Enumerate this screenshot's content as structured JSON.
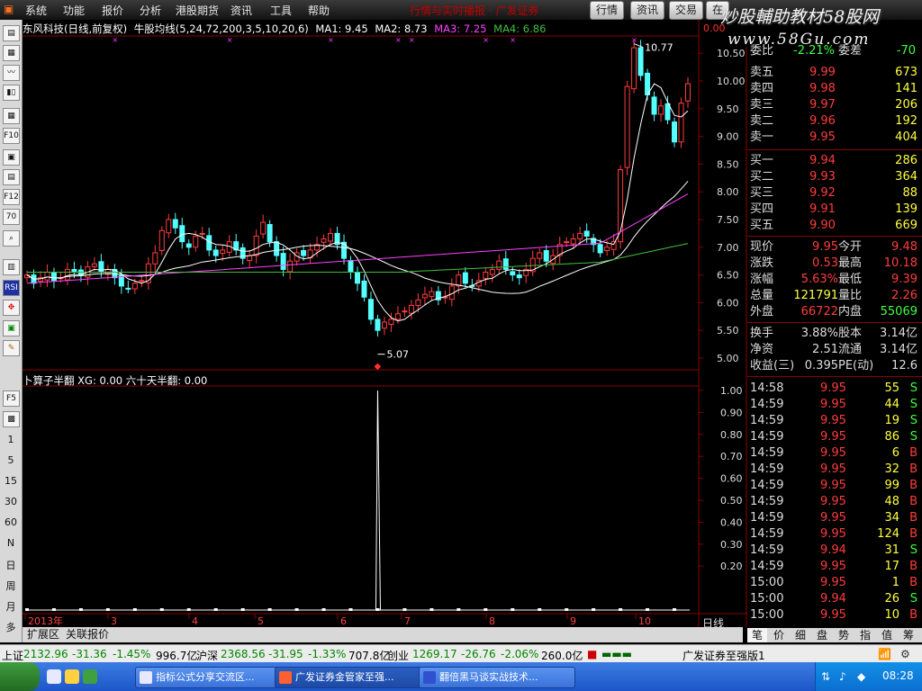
{
  "menubar": {
    "items": [
      "系统",
      "功能",
      "报价",
      "分析",
      "港股期货",
      "资讯",
      "工具",
      "帮助"
    ],
    "marquee": "行情与实时播报 · 广发证券",
    "tabs": [
      "行情",
      "资讯",
      "交易",
      "在"
    ],
    "watermark": "炒股輔助教材58股网",
    "watermark_url": "www.58Gu.com"
  },
  "toolbar": {
    "icons": [
      "app-logo-icon",
      "quote-list-icon",
      "multi-stock-icon",
      "line-chart-icon",
      "kline-icon",
      "f10-icon",
      "f10-doc-icon",
      "finance-icon",
      "notepad-icon",
      "f-icon",
      "70-icon",
      "search-icon",
      "volume-icon",
      "rsi-icon",
      "move-icon",
      "indicator-icon",
      "draw-pen-icon",
      "f5-icon",
      "picture-icon"
    ],
    "labels": [
      "1",
      "5",
      "15",
      "30",
      "60",
      "N",
      "日",
      "周",
      "月",
      "多"
    ]
  },
  "chart": {
    "stock": "东风科技(日线,前复权)",
    "indicator_name": "牛股均线(5,24,72,200,3,5,10,20,6)",
    "ma1": "MA1: 9.45",
    "ma2": "MA2: 8.73",
    "ma3": "MA3: 7.25",
    "ma4": "MA4: 6.86",
    "high_label": "10.77",
    "low_label": "5.07",
    "indicator_legend": "卜算子半翻 XG: 0.00 六十天半翻: 0.00",
    "price_axis": [
      "10.50",
      "10.00",
      "9.50",
      "9.00",
      "8.50",
      "8.00",
      "7.50",
      "7.00",
      "6.50",
      "6.00",
      "5.50",
      "5.00"
    ],
    "ind_axis": [
      "1.00",
      "0.90",
      "0.80",
      "0.70",
      "0.60",
      "0.50",
      "0.40",
      "0.30",
      "0.20"
    ],
    "months": [
      "2013年",
      "3",
      "4",
      "5",
      "6",
      "7",
      "8",
      "9",
      "10"
    ],
    "period": "日线",
    "corner_value": "0.00",
    "colors": {
      "up": "#ff3c3c",
      "down": "#54ffff",
      "ma1": "#ffffff",
      "ma2": "#ffffff",
      "ma3": "#ff40ff",
      "ma4": "#40c040"
    }
  },
  "chart_data": {
    "type": "candlestick",
    "xlabel": "",
    "ylabel": "",
    "ylim": [
      4.9,
      10.6
    ],
    "series": [
      {
        "name": "MA1",
        "value": 9.45
      },
      {
        "name": "MA2",
        "value": 8.73
      },
      {
        "name": "MA3",
        "value": 7.25
      },
      {
        "name": "MA4",
        "value": 6.86
      }
    ],
    "annotations": [
      {
        "label": "10.77"
      },
      {
        "label": "5.07"
      }
    ],
    "closes": [
      6.5,
      6.35,
      6.45,
      6.55,
      6.4,
      6.45,
      6.6,
      6.55,
      6.5,
      6.65,
      6.7,
      6.55,
      6.6,
      6.45,
      6.3,
      6.25,
      6.35,
      6.4,
      6.7,
      6.9,
      7.3,
      7.5,
      7.35,
      7.1,
      7.0,
      7.2,
      7.25,
      6.95,
      6.85,
      6.95,
      7.1,
      6.95,
      6.8,
      6.85,
      7.2,
      7.45,
      7.1,
      6.85,
      6.6,
      6.75,
      6.9,
      6.85,
      6.95,
      7.05,
      7.15,
      7.25,
      7.05,
      6.8,
      6.55,
      6.35,
      6.1,
      5.7,
      5.5,
      5.65,
      5.7,
      5.8,
      5.85,
      5.95,
      6.05,
      6.15,
      6.2,
      6.05,
      6.1,
      6.3,
      6.5,
      6.35,
      6.3,
      6.4,
      6.55,
      6.6,
      6.75,
      6.6,
      6.5,
      6.45,
      6.6,
      6.8,
      6.9,
      6.75,
      6.85,
      7.05,
      7.1,
      7.15,
      7.25,
      7.2,
      7.05,
      6.9,
      7.0,
      7.1,
      8.4,
      9.9,
      10.6,
      10.1,
      9.75,
      9.4,
      9.55,
      9.3,
      8.9,
      9.6,
      9.95
    ],
    "indicator": {
      "name": "XG",
      "signal_day_index": 52,
      "peak": 1.0
    }
  },
  "quote": {
    "partial_row": {
      "label": "委比",
      "value": "-2.21%",
      "label2": "委差",
      "value2": "-70"
    },
    "sell": [
      {
        "label": "卖五",
        "price": "9.99",
        "vol": "673"
      },
      {
        "label": "卖四",
        "price": "9.98",
        "vol": "141"
      },
      {
        "label": "卖三",
        "price": "9.97",
        "vol": "206"
      },
      {
        "label": "卖二",
        "price": "9.96",
        "vol": "192"
      },
      {
        "label": "卖一",
        "price": "9.95",
        "vol": "404"
      }
    ],
    "buy": [
      {
        "label": "买一",
        "price": "9.94",
        "vol": "286"
      },
      {
        "label": "买二",
        "price": "9.93",
        "vol": "364"
      },
      {
        "label": "买三",
        "price": "9.92",
        "vol": "88"
      },
      {
        "label": "买四",
        "price": "9.91",
        "vol": "139"
      },
      {
        "label": "买五",
        "price": "9.90",
        "vol": "669"
      }
    ],
    "stats": [
      {
        "l1": "现价",
        "v1": "9.95",
        "l2": "今开",
        "v2": "9.48",
        "c1": "#ff3c3c",
        "c2": "#ff3c3c"
      },
      {
        "l1": "涨跌",
        "v1": "0.53",
        "l2": "最高",
        "v2": "10.18",
        "c1": "#ff3c3c",
        "c2": "#ff3c3c"
      },
      {
        "l1": "涨幅",
        "v1": "5.63%",
        "l2": "最低",
        "v2": "9.39",
        "c1": "#ff3c3c",
        "c2": "#ff3c3c"
      },
      {
        "l1": "总量",
        "v1": "121791",
        "l2": "量比",
        "v2": "2.26",
        "c1": "#ffff40",
        "c2": "#ff3c3c"
      },
      {
        "l1": "外盘",
        "v1": "66722",
        "l2": "内盘",
        "v2": "55069",
        "c1": "#ff3c3c",
        "c2": "#40ff40"
      }
    ],
    "stats2": [
      {
        "l1": "换手",
        "v1": "3.88%",
        "l2": "股本",
        "v2": "3.14亿"
      },
      {
        "l1": "净资",
        "v1": "2.51",
        "l2": "流通",
        "v2": "3.14亿"
      },
      {
        "l1": "收益(三)",
        "v1": "0.395",
        "l2": "PE(动)",
        "v2": "12.6"
      }
    ],
    "ticks": [
      {
        "time": "14:58",
        "price": "9.95",
        "vol": "55",
        "dir": "S"
      },
      {
        "time": "14:59",
        "price": "9.95",
        "vol": "44",
        "dir": "S"
      },
      {
        "time": "14:59",
        "price": "9.95",
        "vol": "19",
        "dir": "S"
      },
      {
        "time": "14:59",
        "price": "9.95",
        "vol": "86",
        "dir": "S"
      },
      {
        "time": "14:59",
        "price": "9.95",
        "vol": "6",
        "dir": "B"
      },
      {
        "time": "14:59",
        "price": "9.95",
        "vol": "32",
        "dir": "B"
      },
      {
        "time": "14:59",
        "price": "9.95",
        "vol": "99",
        "dir": "B"
      },
      {
        "time": "14:59",
        "price": "9.95",
        "vol": "48",
        "dir": "B"
      },
      {
        "time": "14:59",
        "price": "9.95",
        "vol": "34",
        "dir": "B"
      },
      {
        "time": "14:59",
        "price": "9.95",
        "vol": "124",
        "dir": "B"
      },
      {
        "time": "14:59",
        "price": "9.94",
        "vol": "31",
        "dir": "S"
      },
      {
        "time": "14:59",
        "price": "9.95",
        "vol": "17",
        "dir": "B"
      },
      {
        "time": "15:00",
        "price": "9.95",
        "vol": "1",
        "dir": "B"
      },
      {
        "time": "15:00",
        "price": "9.94",
        "vol": "26",
        "dir": "S"
      },
      {
        "time": "15:00",
        "price": "9.95",
        "vol": "10",
        "dir": "B"
      }
    ]
  },
  "footer": {
    "tabs": [
      "扩展区",
      "关联报价"
    ]
  },
  "panel_tabs": [
    "笔",
    "价",
    "细",
    "盘",
    "势",
    "指",
    "值",
    "筹"
  ],
  "status": {
    "sh_label": "上证",
    "sh_value": "2132.96",
    "sh_chg": "-31.36",
    "sh_pct": "-1.45%",
    "sh_amt": "996.7亿",
    "sz_label": "沪深",
    "sz_value": "2368.56",
    "sz_chg": "-31.95",
    "sz_pct": "-1.33%",
    "sz_amt": "707.8亿",
    "cy_label": "创业",
    "cy_value": "1269.17",
    "cy_chg": "-26.76",
    "cy_pct": "-2.06%",
    "cy_amt": "260.0亿",
    "broker": "广发证券至强版1"
  },
  "taskbar": {
    "tasks": [
      "指标公式分享交流区...",
      "广发证券金管家至强...",
      "翻倍黑马谈实战技术..."
    ],
    "clock": "08:28"
  }
}
